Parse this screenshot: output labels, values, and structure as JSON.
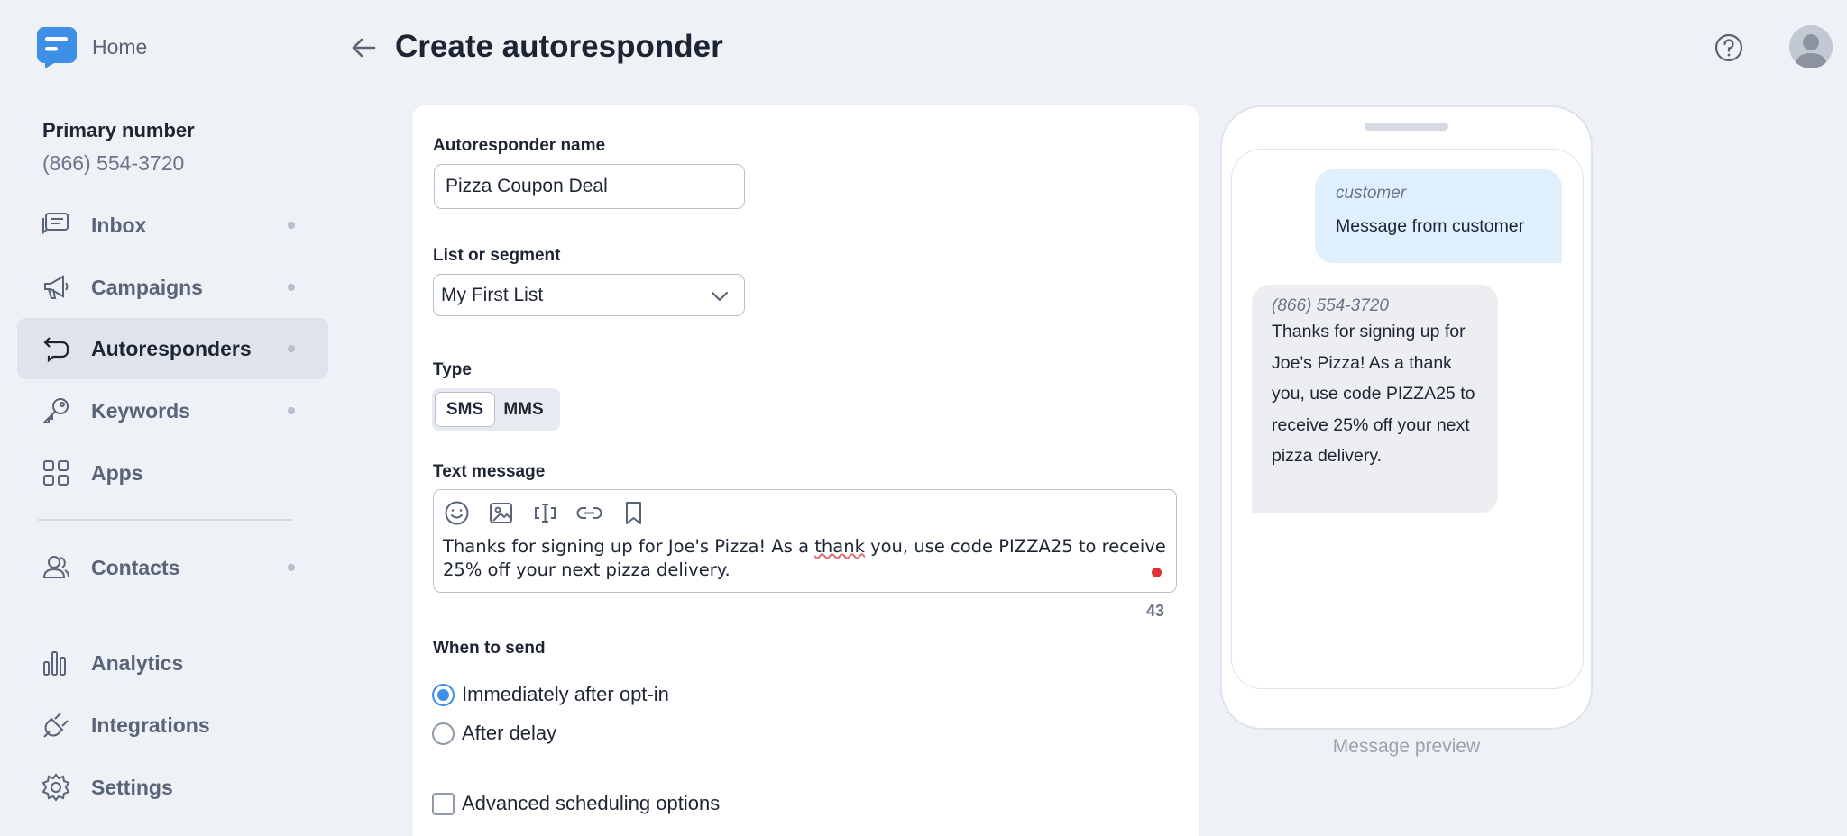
{
  "app": {
    "home_label": "Home"
  },
  "sidebar": {
    "primary_title": "Primary number",
    "primary_number": "(866) 554-3720",
    "items": [
      {
        "label": "Inbox",
        "icon": "inbox-icon",
        "has_dot": true,
        "active": false
      },
      {
        "label": "Campaigns",
        "icon": "megaphone-icon",
        "has_dot": true,
        "active": false
      },
      {
        "label": "Autoresponders",
        "icon": "autoresponder-icon",
        "has_dot": true,
        "active": true
      },
      {
        "label": "Keywords",
        "icon": "key-icon",
        "has_dot": true,
        "active": false
      },
      {
        "label": "Apps",
        "icon": "apps-grid-icon",
        "has_dot": false,
        "active": false
      },
      {
        "label": "Contacts",
        "icon": "contacts-icon",
        "has_dot": true,
        "active": false
      },
      {
        "label": "Analytics",
        "icon": "bar-chart-icon",
        "has_dot": false,
        "active": false
      },
      {
        "label": "Integrations",
        "icon": "plug-icon",
        "has_dot": false,
        "active": false
      },
      {
        "label": "Settings",
        "icon": "gear-icon",
        "has_dot": false,
        "active": false
      }
    ]
  },
  "header": {
    "title": "Create autoresponder"
  },
  "form": {
    "name_label": "Autoresponder name",
    "name_value": "Pizza Coupon Deal",
    "list_label": "List or segment",
    "list_value": "My First List",
    "type_label": "Type",
    "type_options": [
      "SMS",
      "MMS"
    ],
    "type_selected": "SMS",
    "message_label": "Text message",
    "message_before": "Thanks for signing up for Joe's Pizza! As a ",
    "message_misspelled": "thank",
    "message_after": " you, use code PIZZA25 to receive 25% off your next pizza delivery.",
    "char_count": "43",
    "when_label": "When to send",
    "when_options": [
      "Immediately after opt-in",
      "After delay"
    ],
    "when_selected": "Immediately after opt-in",
    "advanced_label": "Advanced scheduling options"
  },
  "preview": {
    "incoming_sender": "customer",
    "incoming_text": "Message from customer",
    "outgoing_sender": "(866) 554-3720",
    "outgoing_text": "Thanks for signing up for Joe's Pizza! As a thank you, use code PIZZA25 to receive 25% off your next pizza delivery.",
    "caption": "Message preview"
  },
  "colors": {
    "accent": "#3d8fe8",
    "background": "#eef1f5",
    "active_nav": "#dfe4ec",
    "incoming_bubble": "#dff0fc",
    "outgoing_bubble": "#eceef2"
  }
}
